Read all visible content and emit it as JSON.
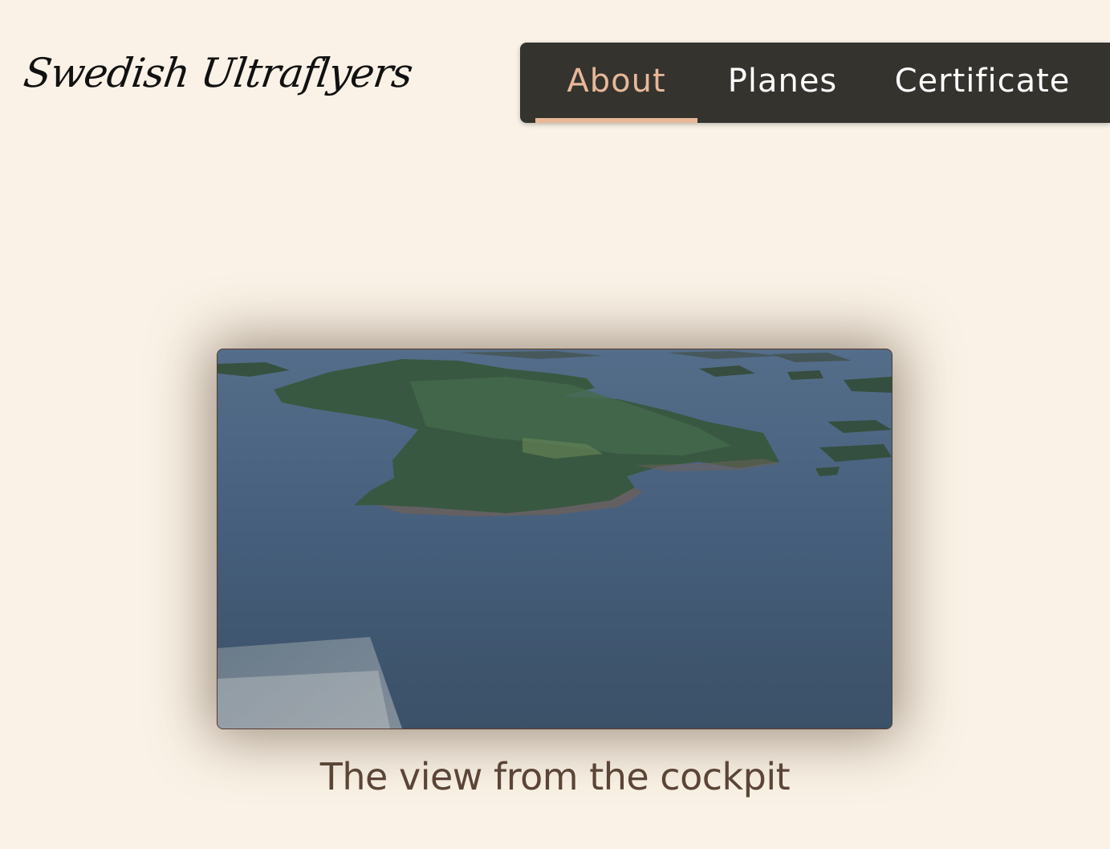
{
  "header": {
    "logo_text": "Swedish Ultraflyers"
  },
  "nav": {
    "items": [
      {
        "label": "About",
        "active": true
      },
      {
        "label": "Planes",
        "active": false
      },
      {
        "label": "Certificate",
        "active": false
      }
    ]
  },
  "main": {
    "video_caption": "The view from the cockpit"
  },
  "colors": {
    "background": "#faf2e6",
    "nav_bg": "#35332e",
    "nav_active": "#e8b898",
    "caption": "#5a4536",
    "video_border": "#5a3a2c"
  }
}
